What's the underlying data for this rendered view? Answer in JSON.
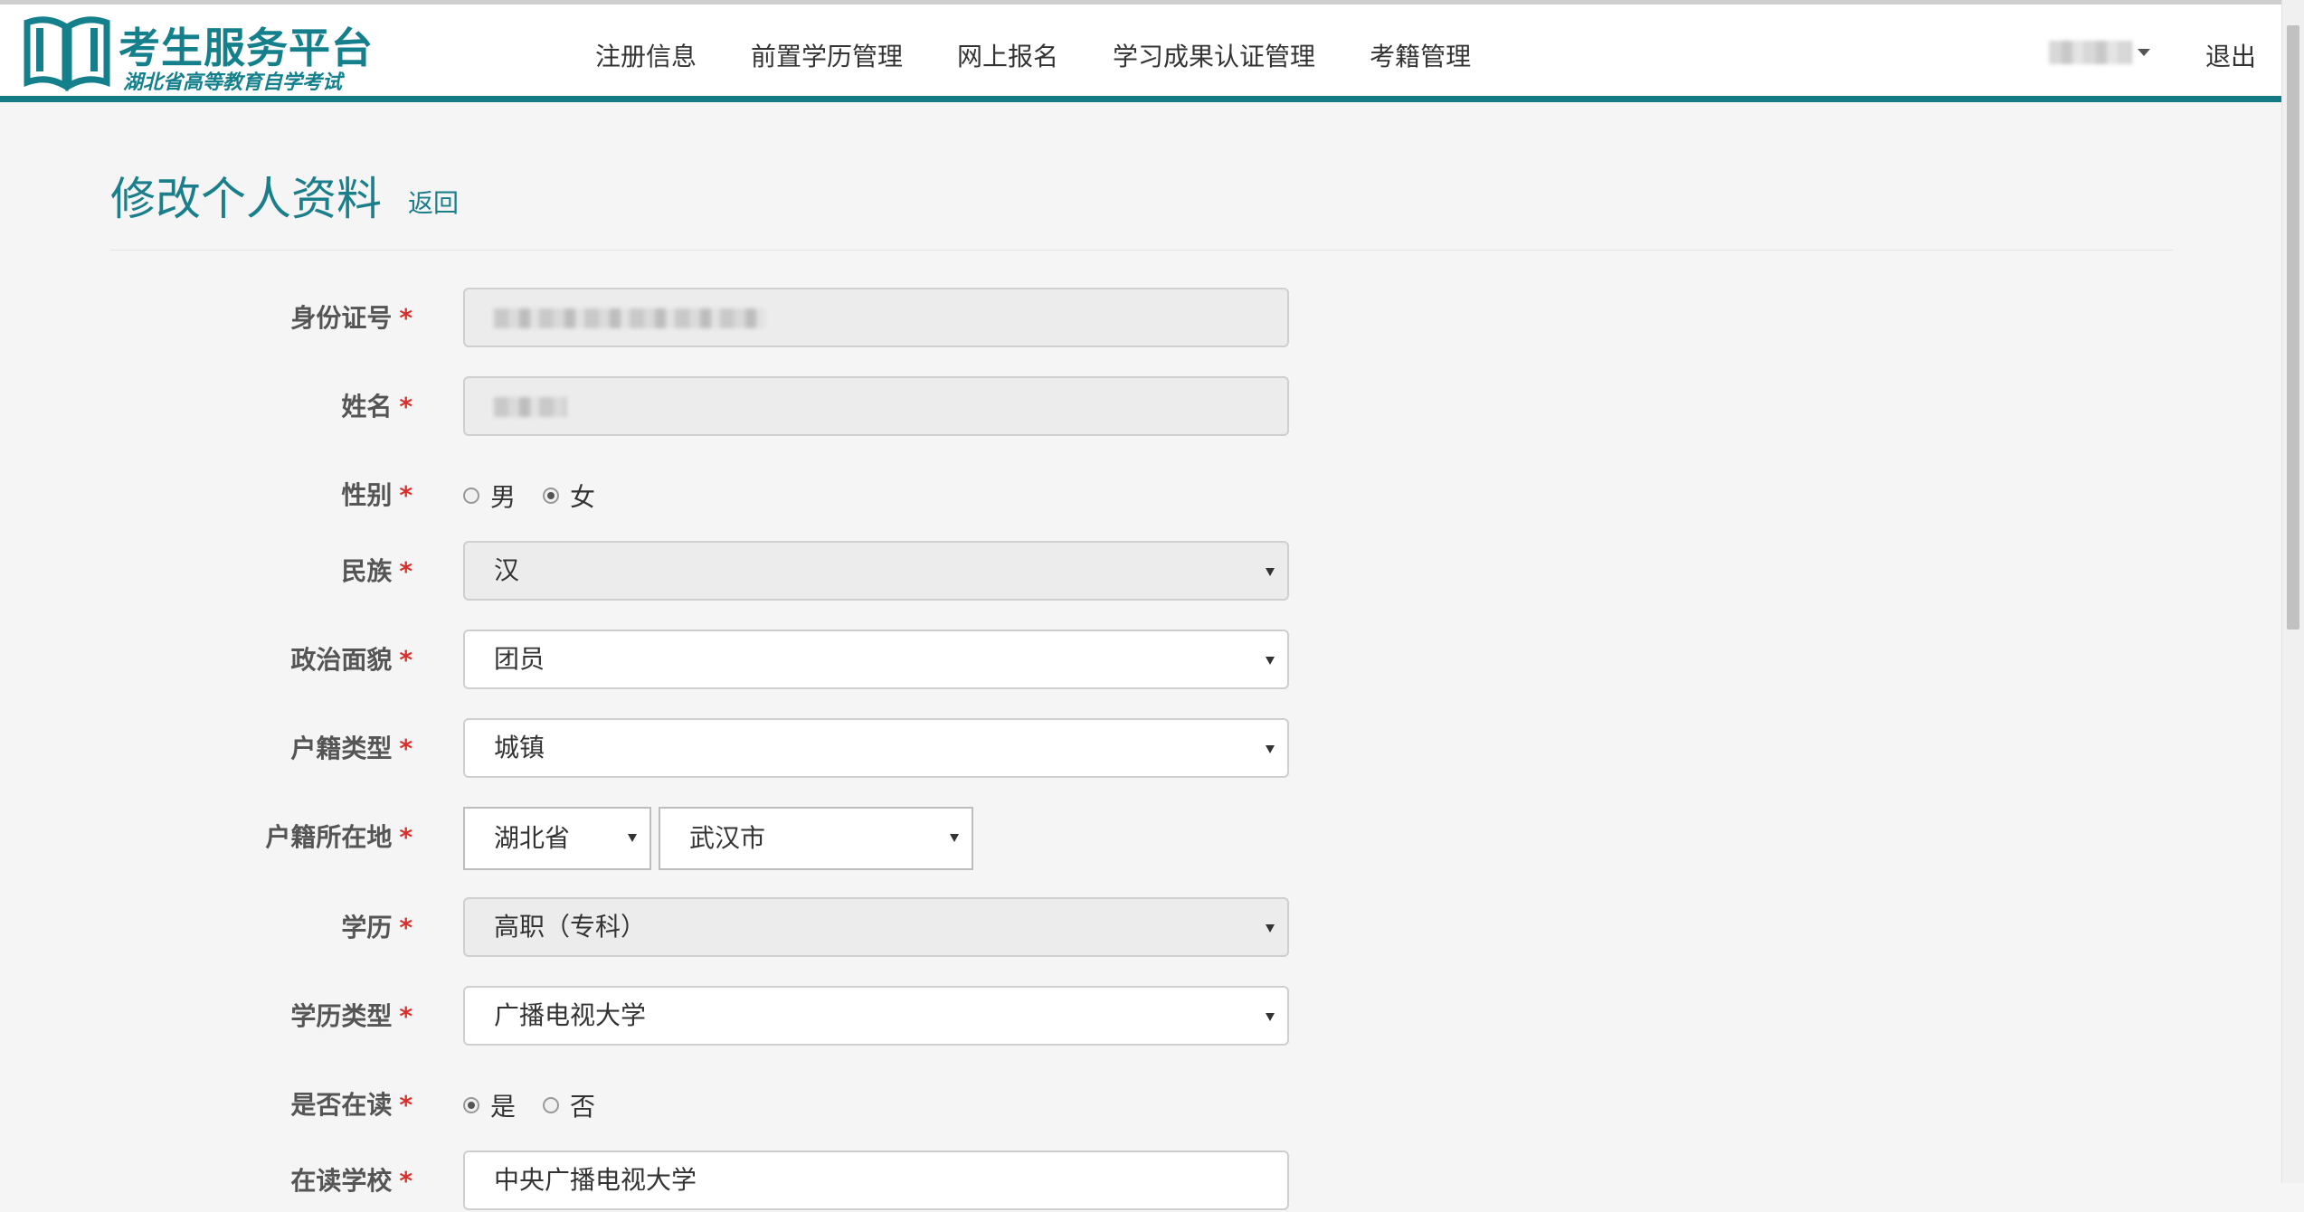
{
  "header": {
    "logo_title": "考生服务平台",
    "logo_subtitle": "湖北省高等教育自学考试",
    "nav": [
      "注册信息",
      "前置学历管理",
      "网上报名",
      "学习成果认证管理",
      "考籍管理"
    ],
    "logout": "退出",
    "brand_color": "#147a86"
  },
  "page": {
    "title": "修改个人资料",
    "back": "返回"
  },
  "form": {
    "required_mark": "*",
    "id_number": {
      "label": "身份证号"
    },
    "name": {
      "label": "姓名"
    },
    "gender": {
      "label": "性别",
      "options": [
        "男",
        "女"
      ],
      "selected": "女"
    },
    "ethnicity": {
      "label": "民族",
      "value": "汉"
    },
    "political_status": {
      "label": "政治面貌",
      "value": "团员"
    },
    "household_type": {
      "label": "户籍类型",
      "value": "城镇"
    },
    "household_location": {
      "label": "户籍所在地",
      "province": "湖北省",
      "city": "武汉市"
    },
    "education": {
      "label": "学历",
      "value": "高职（专科）"
    },
    "education_type": {
      "label": "学历类型",
      "value": "广播电视大学"
    },
    "enrolled": {
      "label": "是否在读",
      "options": [
        "是",
        "否"
      ],
      "selected": "是"
    },
    "school": {
      "label": "在读学校",
      "value": "中央广播电视大学"
    }
  }
}
